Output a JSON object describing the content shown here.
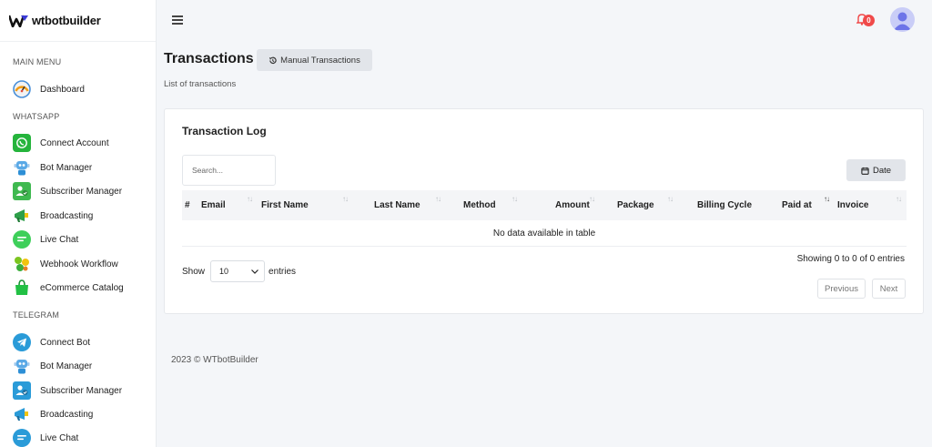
{
  "brand": {
    "name": "wtbotbuilder"
  },
  "sidebar": {
    "sections": [
      {
        "label": "MAIN MENU"
      },
      {
        "label": "WHATSAPP"
      },
      {
        "label": "TELEGRAM"
      }
    ],
    "main_items": [
      {
        "label": "Dashboard",
        "icon": "speedometer-icon",
        "color": "#f39c12"
      }
    ],
    "whatsapp_items": [
      {
        "label": "Connect Account",
        "icon": "whatsapp-icon",
        "color": "#25b43c"
      },
      {
        "label": "Bot Manager",
        "icon": "robot-icon",
        "color": "#2d8fd6"
      },
      {
        "label": "Subscriber Manager",
        "icon": "subscriber-icon",
        "color": "#3fb950"
      },
      {
        "label": "Broadcasting",
        "icon": "broadcast-icon",
        "color": "#2e9f4a"
      },
      {
        "label": "Live Chat",
        "icon": "chat-icon",
        "color": "#3ecf5a"
      },
      {
        "label": "Webhook Workflow",
        "icon": "webhook-icon",
        "color": "#7cc520"
      },
      {
        "label": "eCommerce Catalog",
        "icon": "shopping-bag-icon",
        "color": "#22c044"
      }
    ],
    "telegram_items": [
      {
        "label": "Connect Bot",
        "icon": "telegram-icon",
        "color": "#2a9bd8"
      },
      {
        "label": "Bot Manager",
        "icon": "robot-icon",
        "color": "#2d8fd6"
      },
      {
        "label": "Subscriber Manager",
        "icon": "subscriber-icon",
        "color": "#2a9bd8"
      },
      {
        "label": "Broadcasting",
        "icon": "broadcast-icon",
        "color": "#2a9bd8"
      },
      {
        "label": "Live Chat",
        "icon": "chat-icon",
        "color": "#2a9bd8"
      }
    ]
  },
  "topbar": {
    "notification_count": "0"
  },
  "page": {
    "title": "Transactions",
    "subtitle": "List of transactions",
    "manual_button": "Manual Transactions"
  },
  "card": {
    "title": "Transaction Log",
    "search_placeholder": "Search...",
    "date_button": "Date",
    "columns": [
      "#",
      "Email",
      "First Name",
      "Last Name",
      "Method",
      "Amount",
      "Package",
      "Billing Cycle",
      "Paid at",
      "Invoice"
    ],
    "empty_message": "No data available in table",
    "show_label": "Show",
    "page_size": "10",
    "entries_label": "entries",
    "info": "Showing 0 to 0 of 0 entries",
    "previous": "Previous",
    "next": "Next"
  },
  "footer": {
    "text": "2023 © WTbotBuilder"
  },
  "colors": {
    "accent": "#f04a4a",
    "button_bg": "#e2e5ea",
    "page_bg": "#f4f6f9"
  }
}
